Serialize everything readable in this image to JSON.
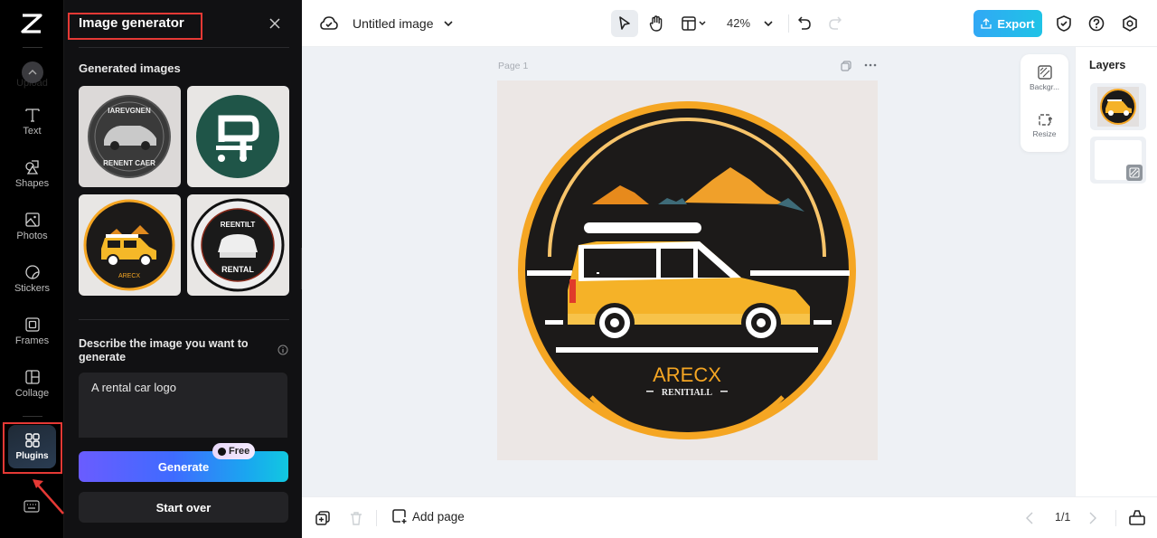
{
  "rail": {
    "upload_label": "Upload",
    "items": [
      {
        "label": "Text",
        "icon": "text-icon"
      },
      {
        "label": "Shapes",
        "icon": "shapes-icon"
      },
      {
        "label": "Photos",
        "icon": "photos-icon"
      },
      {
        "label": "Stickers",
        "icon": "stickers-icon"
      },
      {
        "label": "Frames",
        "icon": "frames-icon"
      },
      {
        "label": "Collage",
        "icon": "collage-icon"
      }
    ],
    "plugins_label": "Plugins"
  },
  "panel": {
    "title": "Image generator",
    "generated_label": "Generated images",
    "thumbnails": [
      {
        "caption_top": "IAREVGNEN",
        "caption_bottom": "RENENT CAER"
      },
      {
        "caption_top": "",
        "caption_bottom": ""
      },
      {
        "caption_top": "",
        "caption_bottom": "ARECX"
      },
      {
        "caption_top": "REENTILT",
        "caption_bottom": "RENTAL"
      }
    ],
    "describe_label": "Describe the image you want to generate",
    "prompt_value": "A rental car logo",
    "generate_label": "Generate",
    "free_badge": "Free",
    "start_over_label": "Start over"
  },
  "topbar": {
    "doc_title": "Untitled image",
    "zoom": "42%",
    "export_label": "Export"
  },
  "canvas": {
    "page_label": "Page 1",
    "logo_title": "ARECX",
    "logo_subtitle": "RENITIALL"
  },
  "float_tools": {
    "background_label": "Backgr...",
    "resize_label": "Resize"
  },
  "layers": {
    "title": "Layers"
  },
  "bottombar": {
    "add_page_label": "Add page",
    "page_count": "1/1"
  },
  "colors": {
    "accent_export": "#1fc3e6",
    "annotation_red": "#e53935",
    "logo_orange": "#f5a623",
    "logo_black": "#1c1a19"
  }
}
